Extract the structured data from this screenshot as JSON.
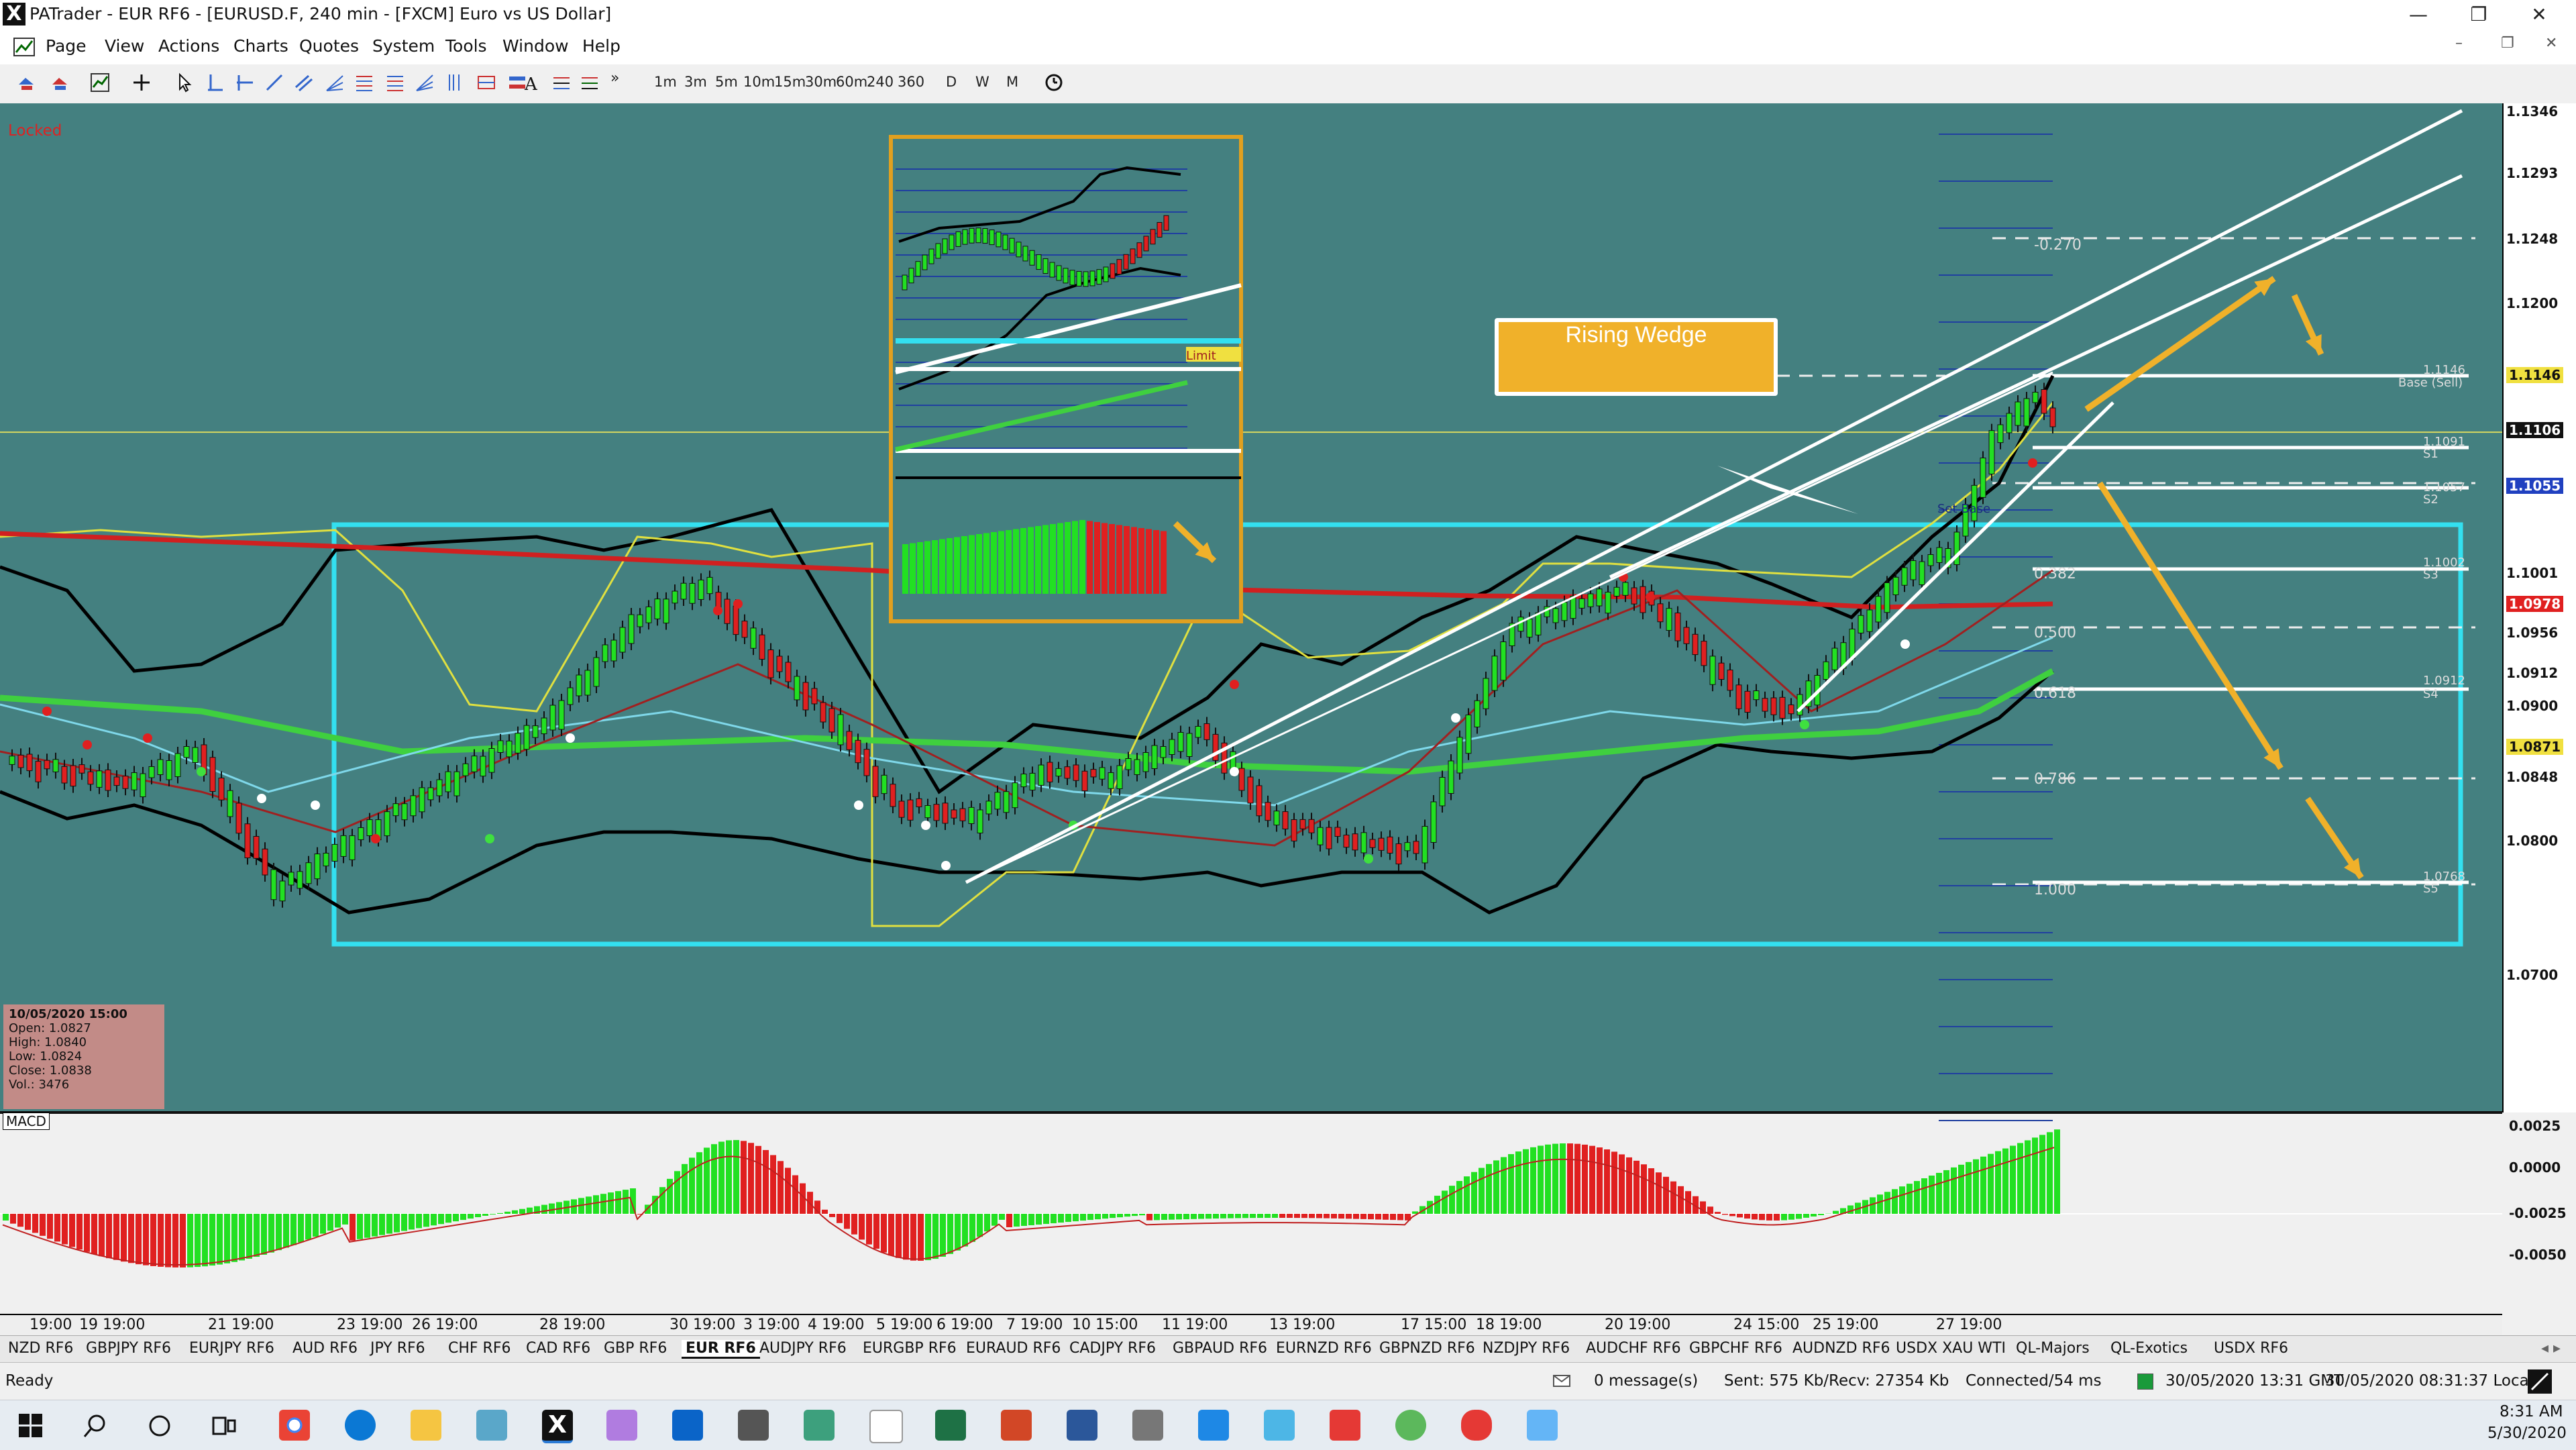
{
  "titlebar": {
    "app_letter": "X",
    "title": "PATrader - EUR RF6 - [EURUSD.F, 240 min - [FXCM] Euro vs US Dollar]",
    "minimize": "—",
    "maximize": "❐",
    "close": "✕"
  },
  "menu": {
    "items": [
      "Page",
      "View",
      "Actions",
      "Charts",
      "Quotes",
      "System",
      "Tools",
      "Window",
      "Help"
    ],
    "mdi": {
      "minimize": "–",
      "restore": "❐",
      "close": "✕"
    }
  },
  "toolbar": {
    "timeframes": [
      "1m",
      "3m",
      "5m",
      "10m",
      "15m",
      "30m",
      "60m",
      "240",
      "360",
      "D",
      "W",
      "M"
    ],
    "overflow": "»"
  },
  "chart": {
    "locked": "Locked",
    "callout": "Rising Wedge",
    "price_labels": [
      "1.1346",
      "1.1293",
      "1.1248",
      "1.1200",
      "1.1146",
      "1.1106",
      "1.1055",
      "1.1001",
      "1.0978",
      "1.0956",
      "1.0912",
      "1.0900",
      "1.0871",
      "1.0848",
      "1.0800",
      "1.0700"
    ],
    "macd_price_labels": [
      "0.0025",
      "0.0000",
      "-0.0025",
      "-0.0050"
    ],
    "fib_labels": [
      "-0.270",
      "0.382",
      "0.500",
      "0.618",
      "0.786",
      "1.000"
    ],
    "level_labels": [
      "1.1146",
      "Base (Sell)",
      "1.1091",
      "S1",
      "1.1057",
      "S2",
      "1.1002",
      "S3",
      "1.0912",
      "S4",
      "1.0768",
      "S5"
    ],
    "inset_labels": [
      "Limit",
      "Limit"
    ],
    "base_label": "Set Base",
    "time_labels": [
      "19:00",
      "19 19:00",
      "21 19:00",
      "23 19:00",
      "26 19:00",
      "28 19:00",
      "30 19:00",
      "3 19:00",
      "4 19:00",
      "5 19:00",
      "6 19:00",
      "7 19:00",
      "10 15:00",
      "11 19:00",
      "13 19:00",
      "17 15:00",
      "18 19:00",
      "20 19:00",
      "24 15:00",
      "25 19:00",
      "27 19:00"
    ]
  },
  "data_window": {
    "date": "10/05/2020 15:00",
    "open": "Open: 1.0827",
    "high": "High: 1.0840",
    "low": "Low: 1.0824",
    "close": "Close: 1.0838",
    "vol": "Vol.: 3476"
  },
  "macd": {
    "label": "MACD"
  },
  "symbol_tabs": [
    "NZD RF6",
    "GBPJPY RF6",
    "EURJPY RF6",
    "AUD RF6",
    "JPY RF6",
    "CHF RF6",
    "CAD RF6",
    "GBP RF6",
    "EUR RF6",
    "AUDJPY RF6",
    "EURGBP RF6",
    "EURAUD RF6",
    "CADJPY RF6",
    "GBPAUD RF6",
    "EURNZD RF6",
    "GBPNZD RF6",
    "NZDJPY RF6",
    "AUDCHF RF6",
    "GBPCHF RF6",
    "AUDNZD RF6",
    "USDX XAU WTI",
    "QL-Majors",
    "QL-Exotics",
    "USDX RF6"
  ],
  "active_tab": "EUR RF6",
  "status": {
    "ready": "Ready",
    "messages": "0 message(s)",
    "sent": "Sent: 575 Kb/Recv: 27354 Kb",
    "connected": "Connected/54 ms",
    "gmt": "30/05/2020 13:31 GMT",
    "local": "30/05/2020 08:31:37 Local"
  },
  "taskbar": {
    "time": "8:31 AM",
    "date": "5/30/2020"
  },
  "colors": {
    "chart_bg": "#448080",
    "bull": "#22e022",
    "bear": "#e02020",
    "wedge": "#ffffff",
    "arrow": "#f0b12a",
    "box": "#33e0f0"
  }
}
